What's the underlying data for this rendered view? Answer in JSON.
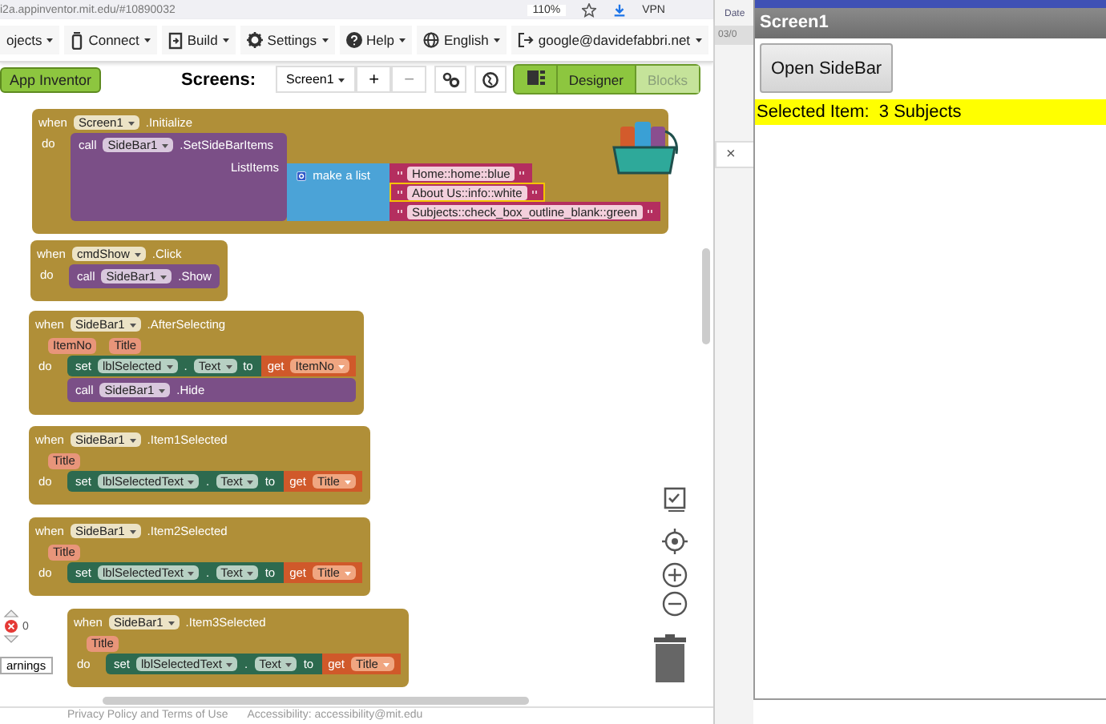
{
  "browser": {
    "url": "i2a.appinventor.mit.edu/#10890032",
    "zoom": "110%",
    "vpn": "VPN"
  },
  "menu": [
    {
      "label": "ojects"
    },
    {
      "label": "Connect"
    },
    {
      "label": "Build"
    },
    {
      "label": "Settings"
    },
    {
      "label": "Help"
    },
    {
      "label": "English"
    },
    {
      "label": "google@davidefabbri.net"
    }
  ],
  "toolbar": {
    "app_button": "App Inventor",
    "screens_label": "Screens:",
    "screen": "Screen1",
    "add": "+",
    "remove": "−",
    "modes": [
      {
        "label": "Designer",
        "selected": false
      },
      {
        "label": "Blocks",
        "selected": true
      }
    ]
  },
  "events": [
    {
      "when": "when",
      "component": "Screen1",
      "event": ".Initialize",
      "do": "do",
      "statements": [
        {
          "kind": "call",
          "keyword": "call",
          "component": "SideBar1",
          "method": ".SetSideBarItems",
          "arg_label": "ListItems",
          "list": {
            "label": "make a list",
            "items": [
              {
                "text": "Home::home::blue",
                "selected": false
              },
              {
                "text": "About Us::info::white",
                "selected": true
              },
              {
                "text": "Subjects::check_box_outline_blank::green",
                "selected": false
              }
            ]
          }
        }
      ]
    },
    {
      "when": "when",
      "component": "cmdShow",
      "event": ".Click",
      "do": "do",
      "statements": [
        {
          "kind": "call",
          "keyword": "call",
          "component": "SideBar1",
          "method": ".Show"
        }
      ]
    },
    {
      "when": "when",
      "component": "SideBar1",
      "event": ".AfterSelecting",
      "params": [
        "ItemNo",
        "Title"
      ],
      "do": "do",
      "statements": [
        {
          "kind": "set",
          "keyword": "set",
          "component": "lblSelected",
          "dot": ".",
          "property": "Text",
          "to": "to",
          "get": "get",
          "variable": "ItemNo"
        },
        {
          "kind": "call",
          "keyword": "call",
          "component": "SideBar1",
          "method": ".Hide"
        }
      ]
    },
    {
      "when": "when",
      "component": "SideBar1",
      "event": ".Item1Selected",
      "params": [
        "Title"
      ],
      "do": "do",
      "statements": [
        {
          "kind": "set",
          "keyword": "set",
          "component": "lblSelectedText",
          "dot": ".",
          "property": "Text",
          "to": "to",
          "get": "get",
          "variable": "Title"
        }
      ]
    },
    {
      "when": "when",
      "component": "SideBar1",
      "event": ".Item2Selected",
      "params": [
        "Title"
      ],
      "do": "do",
      "statements": [
        {
          "kind": "set",
          "keyword": "set",
          "component": "lblSelectedText",
          "dot": ".",
          "property": "Text",
          "to": "to",
          "get": "get",
          "variable": "Title"
        }
      ]
    },
    {
      "when": "when",
      "component": "SideBar1",
      "event": ".Item3Selected",
      "params": [
        "Title"
      ],
      "do": "do",
      "statements": [
        {
          "kind": "set",
          "keyword": "set",
          "component": "lblSelectedText",
          "dot": ".",
          "property": "Text",
          "to": "to",
          "get": "get",
          "variable": "Title"
        }
      ]
    }
  ],
  "warnings": {
    "count": "0",
    "label": "arnings"
  },
  "footer": [
    "Privacy Policy and Terms of Use",
    "Accessibility: accessibility@mit.edu"
  ],
  "side": {
    "date_label": "Date",
    "date_value": "03/0",
    "close": "×"
  },
  "phone": {
    "title": "Screen1",
    "button": "Open SideBar",
    "label": "Selected Item:  3 Subjects"
  }
}
